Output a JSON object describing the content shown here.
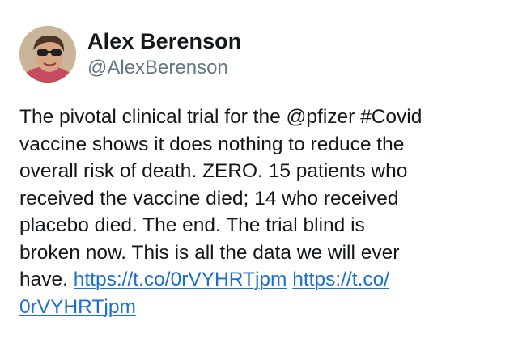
{
  "tweet": {
    "author": {
      "display_name": "Alex Berenson",
      "handle": "@AlexBerenson",
      "avatar_icon": "profile-photo"
    },
    "text_lines": [
      "The pivotal clinical trial for the @pfizer #Covid",
      "vaccine shows it does nothing to reduce the",
      "overall risk of death. ZERO. 15 patients who",
      "received the vaccine died; 14 who received",
      "placebo died. The end. The trial blind is",
      "broken now. This is all the data we will ever",
      "have."
    ],
    "links": {
      "first": "https://t.co/0rVYHRTjpm",
      "second_part1": "https://t.co/",
      "second_part2": "0rVYHRTjpm"
    },
    "colors": {
      "text": "#14171a",
      "handle": "#657786",
      "link": "#1b6fd1"
    }
  }
}
